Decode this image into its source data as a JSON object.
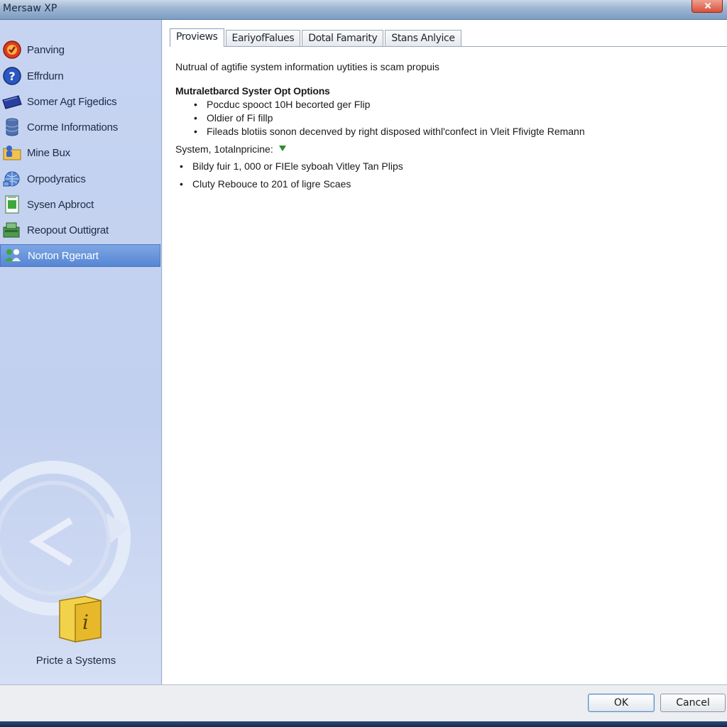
{
  "window": {
    "title": "Mersaw XP"
  },
  "sidebar": {
    "items": [
      {
        "label": "Panving",
        "icon": "red-shield-icon"
      },
      {
        "label": "Effrdurn",
        "icon": "blue-help-icon"
      },
      {
        "label": "Somer Agt Figedics",
        "icon": "blue-device-icon"
      },
      {
        "label": "Corme Informations",
        "icon": "database-icon"
      },
      {
        "label": "Mine Bux",
        "icon": "folder-person-icon"
      },
      {
        "label": "Orpodyratics",
        "icon": "network-globe-icon"
      },
      {
        "label": "Sysen Apbroct",
        "icon": "green-document-icon"
      },
      {
        "label": "Reopout Outtigrat",
        "icon": "green-hardware-icon"
      },
      {
        "label": "Norton Rgenart",
        "icon": "network-people-icon"
      }
    ],
    "selected_index": 8,
    "caption": "Pricte a Systems"
  },
  "tabs": [
    {
      "label": "Proviews",
      "active": true
    },
    {
      "label": "EariyofFalues",
      "active": false
    },
    {
      "label": "Dotal Famarity",
      "active": false
    },
    {
      "label": "Stans Anlyice",
      "active": false
    }
  ],
  "content": {
    "intro": "Nutrual of agtifie system information uytities is scam propuis",
    "section_title": "Mutraletbarcd Syster Opt Options",
    "bullets1": [
      "Pocduc spooct 10H becorted ger Flip",
      "Oldier of Fi fillp",
      "Fileads blotiis sonon decenved by right disposed withl'confect in Vleit Ffivigte Remann"
    ],
    "system_label": "System, 1otalnpricine:",
    "bullets2": [
      "Bildy fuir 1, 000 or FIEle syboah Vitley Tan Plips",
      "Cluty Rebouce to 201 of ligre Scaes"
    ]
  },
  "buttons": {
    "ok": "OK",
    "cancel": "Cancel"
  },
  "colors": {
    "sidebar_bg": "#c4d2f0",
    "selected_item": "#5686d4",
    "title_bar": "#9fb7d3"
  }
}
